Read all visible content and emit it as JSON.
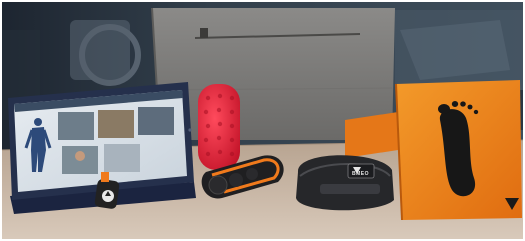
{
  "image": {
    "kind": "product-photo",
    "strap_text": "BMEO",
    "colors": {
      "wall": "#2e3a46",
      "table": "#c9b9a8",
      "bag": "#7c7b79",
      "roller": "#e8283e",
      "orange_box": "#ee7e18",
      "device_orange": "#f07a1c",
      "tablet_case": "#25304c"
    }
  },
  "icons": [
    "footprint-icon",
    "brand-logo-icon"
  ]
}
